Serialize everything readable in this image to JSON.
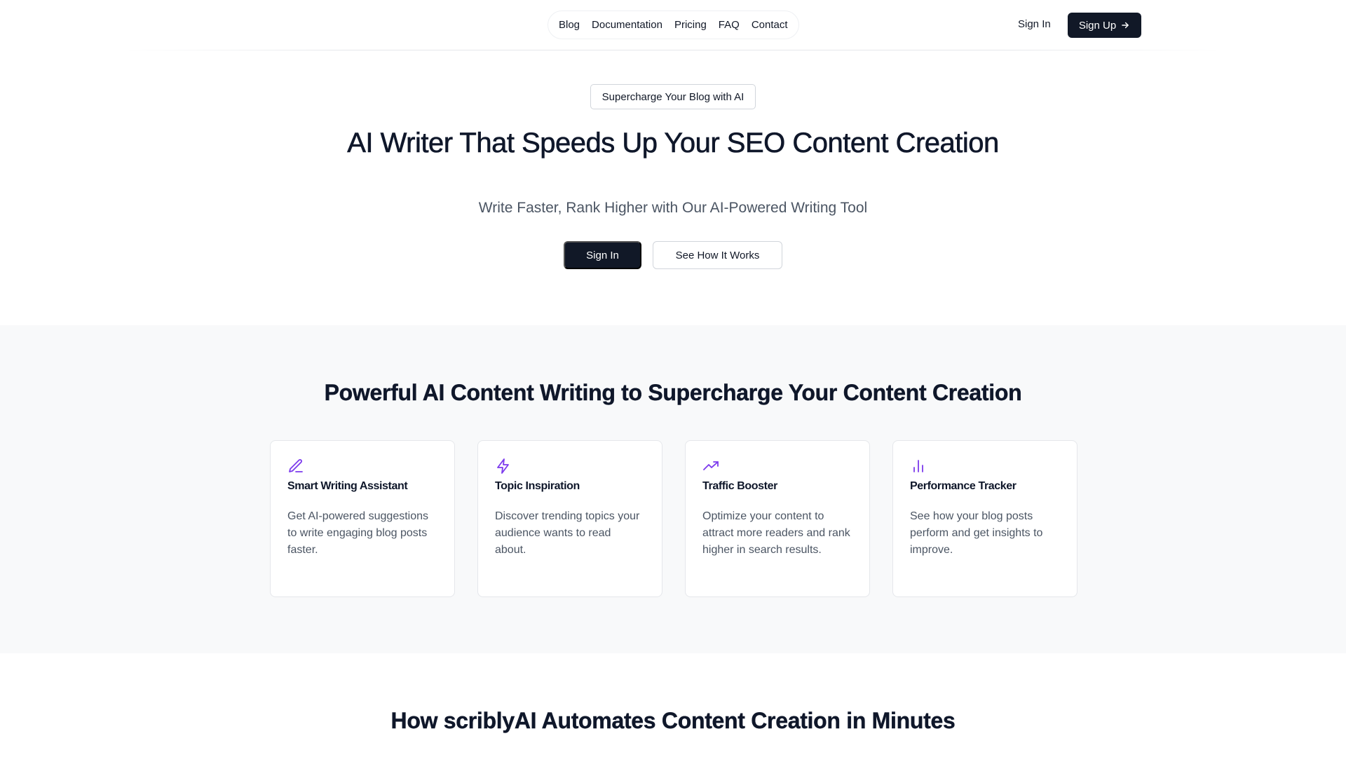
{
  "nav": {
    "links": [
      {
        "label": "Blog"
      },
      {
        "label": "Documentation"
      },
      {
        "label": "Pricing"
      },
      {
        "label": "FAQ"
      },
      {
        "label": "Contact"
      }
    ],
    "signin_label": "Sign In",
    "signup_label": "Sign Up",
    "signup_icon": "arrow-right-icon"
  },
  "hero": {
    "badge": "Supercharge Your Blog with AI",
    "title": "AI Writer That Speeds Up Your SEO Content Creation",
    "subtitle": "Write Faster, Rank Higher with Our AI-Powered Writing Tool",
    "primary_button": "Sign In",
    "secondary_button": "See How It Works"
  },
  "features": {
    "title": "Powerful AI Content Writing to Supercharge Your Content Creation",
    "accent_color": "#7c3aed",
    "cards": [
      {
        "icon": "pen-icon",
        "title": "Smart Writing Assistant",
        "description": "Get AI-powered suggestions to write engaging blog posts faster."
      },
      {
        "icon": "lightning-icon",
        "title": "Topic Inspiration",
        "description": "Discover trending topics your audience wants to read about."
      },
      {
        "icon": "trending-up-icon",
        "title": "Traffic Booster",
        "description": "Optimize your content to attract more readers and rank higher in search results."
      },
      {
        "icon": "bar-chart-icon",
        "title": "Performance Tracker",
        "description": "See how your blog posts perform and get insights to improve."
      }
    ]
  },
  "how": {
    "title": "How scriblyAI Automates Content Creation in Minutes"
  }
}
